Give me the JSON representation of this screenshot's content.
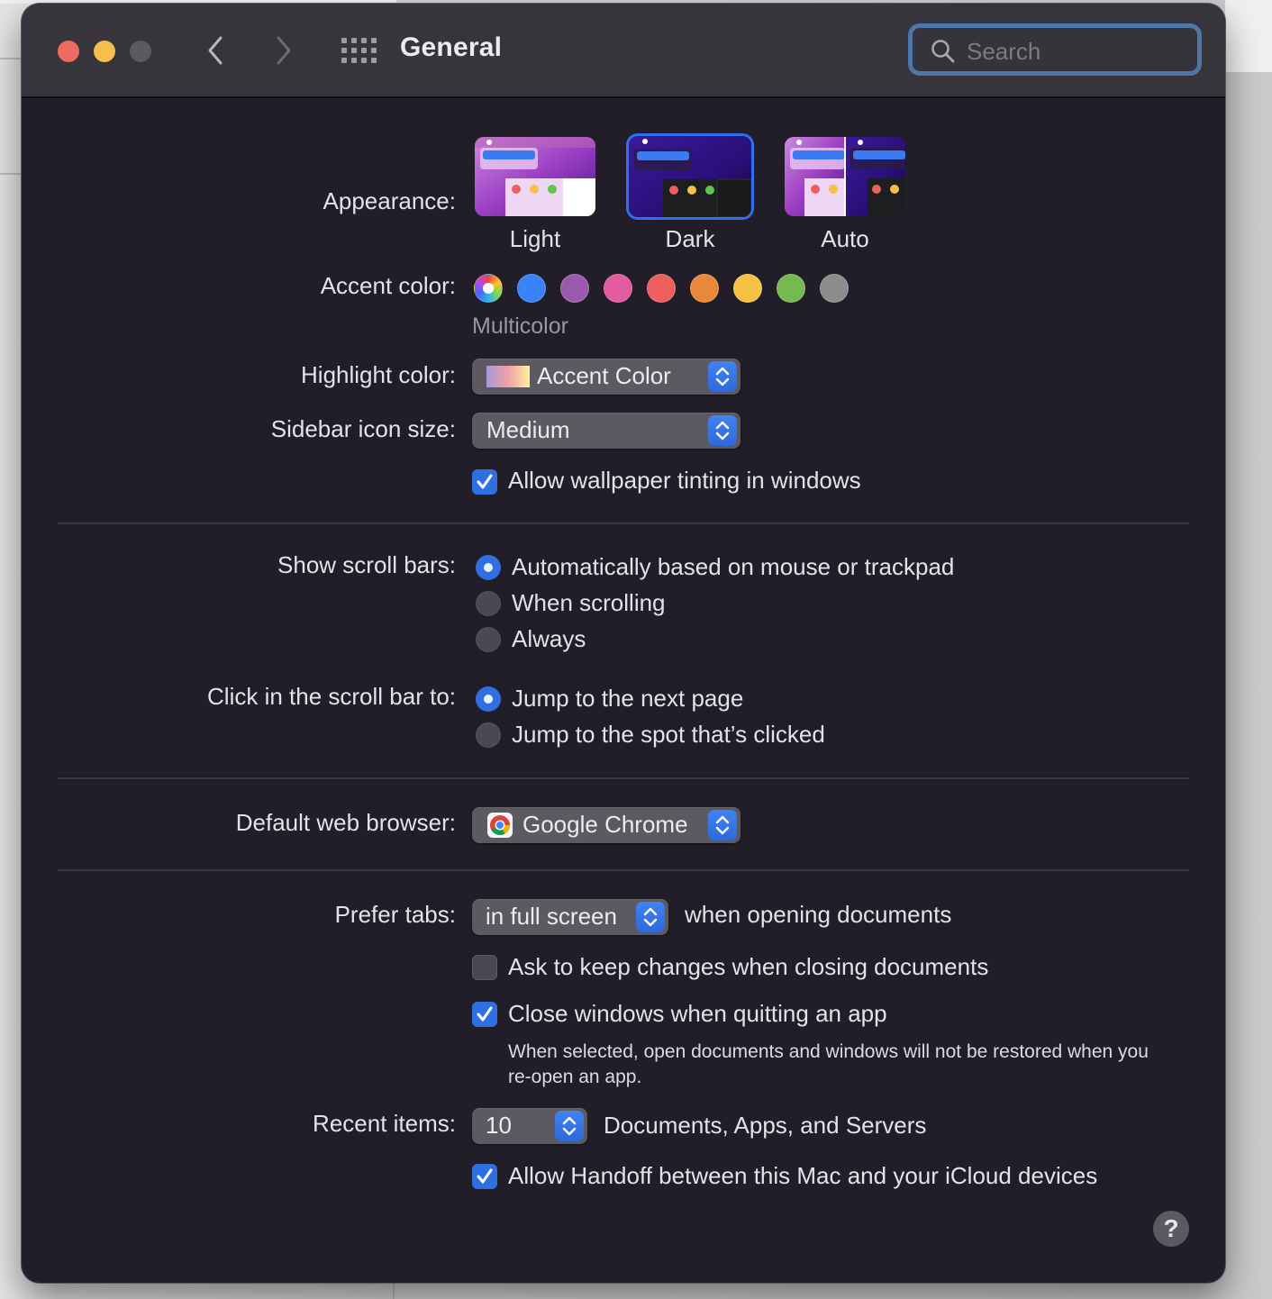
{
  "window": {
    "title": "General",
    "search": {
      "placeholder": "Search",
      "value": ""
    }
  },
  "appearance": {
    "label": "Appearance:",
    "options": [
      {
        "name": "Light",
        "selected": false
      },
      {
        "name": "Dark",
        "selected": true
      },
      {
        "name": "Auto",
        "selected": false
      }
    ]
  },
  "accent": {
    "label": "Accent color:",
    "selected_name": "Multicolor",
    "colors": [
      {
        "name": "Multicolor",
        "hex": "multicolor",
        "selected": true
      },
      {
        "name": "Blue",
        "hex": "#3a82f7",
        "selected": false
      },
      {
        "name": "Purple",
        "hex": "#9b59ae",
        "selected": false
      },
      {
        "name": "Pink",
        "hex": "#e25b9f",
        "selected": false
      },
      {
        "name": "Red",
        "hex": "#ec5f5d",
        "selected": false
      },
      {
        "name": "Orange",
        "hex": "#e8883a",
        "selected": false
      },
      {
        "name": "Yellow",
        "hex": "#f5c243",
        "selected": false
      },
      {
        "name": "Green",
        "hex": "#76b852",
        "selected": false
      },
      {
        "name": "Graphite",
        "hex": "#8c8c8c",
        "selected": false
      }
    ]
  },
  "highlight": {
    "label": "Highlight color:",
    "value": "Accent Color"
  },
  "sidebar_icon_size": {
    "label": "Sidebar icon size:",
    "value": "Medium"
  },
  "wallpaper_tinting": {
    "label": "Allow wallpaper tinting in windows",
    "checked": true
  },
  "show_scroll_bars": {
    "label": "Show scroll bars:",
    "options": [
      {
        "label": "Automatically based on mouse or trackpad",
        "selected": true
      },
      {
        "label": "When scrolling",
        "selected": false
      },
      {
        "label": "Always",
        "selected": false
      }
    ]
  },
  "click_scroll_bar": {
    "label": "Click in the scroll bar to:",
    "options": [
      {
        "label": "Jump to the next page",
        "selected": true
      },
      {
        "label": "Jump to the spot that’s clicked",
        "selected": false
      }
    ]
  },
  "default_browser": {
    "label": "Default web browser:",
    "value": "Google Chrome"
  },
  "prefer_tabs": {
    "label": "Prefer tabs:",
    "value": "in full screen",
    "suffix": "when opening documents"
  },
  "ask_keep_changes": {
    "label": "Ask to keep changes when closing documents",
    "checked": false
  },
  "close_windows": {
    "label": "Close windows when quitting an app",
    "checked": true,
    "description": "When selected, open documents and windows will not be restored when you re-open an app."
  },
  "recent_items": {
    "label": "Recent items:",
    "value": "10",
    "suffix": "Documents, Apps, and Servers"
  },
  "handoff": {
    "label": "Allow Handoff between this Mac and your iCloud devices",
    "checked": true
  },
  "help": {
    "label": "?"
  }
}
